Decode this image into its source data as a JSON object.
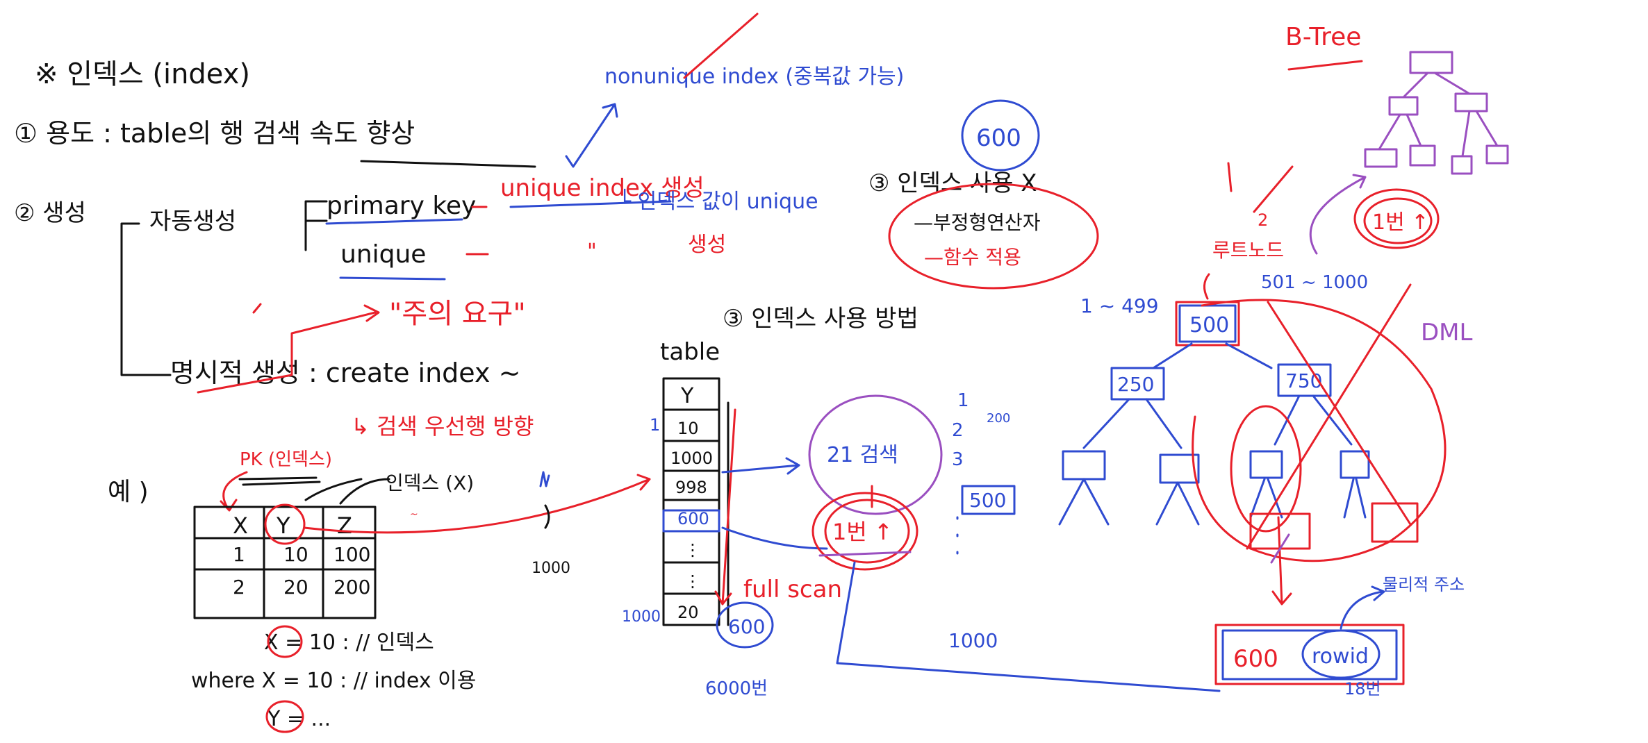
{
  "colors": {
    "ink": "#111111",
    "red": "#e8202a",
    "blue": "#2f4bd1",
    "purple": "#9a4fc0",
    "background": "#ffffff"
  },
  "title": "※ 인덱스 (index)",
  "note1": "① 용도 : table의 행 검색 속도 향상",
  "note2": "② 생성",
  "auto_create": "자동생성",
  "primary_key": "primary key",
  "unique": "unique",
  "unique_index": "unique index 생성",
  "nonunique_index": "nonunique index (중복값 가능)",
  "index_value_unique": "└ 인덱스 값이 unique",
  "create_suffix": "생성",
  "ditto": "\"",
  "manual_create": "명시적 생성 : create index ~",
  "caution": "\"주의 요구\"",
  "search_first": "↳ 검색 우선행 방향",
  "example": "예 )",
  "pk_label": "PK (인덱스)",
  "index_x_label": "인덱스 (X)",
  "table_headers": [
    "X",
    "Y",
    "Z"
  ],
  "table_rows": [
    [
      "1",
      "10",
      "100"
    ],
    [
      "2",
      "20",
      "200"
    ]
  ],
  "where1": "X = 10 : // 인덱스",
  "where2": "where X = 10 : // index 이용",
  "where3": "Y = ...",
  "col_table": "table",
  "col_header": "Y",
  "col_values": [
    "10",
    "1000",
    "998",
    "600",
    "⋮",
    "⋮",
    "20"
  ],
  "col_1": "1",
  "col_1000": "1000",
  "full_scan": "full scan",
  "num_1000_small": "1000",
  "num_600_bottom": "600",
  "num_6000": "6000번",
  "num_600_top": "600",
  "usage3_title": "③ 인덱스 사용 X",
  "usage3_a": "—부정형연산자",
  "usage3_b": "—함수 적용",
  "usage3_section": "③ 인덱스 사용 방법",
  "circle_21": "21 검색",
  "circle_1": "1번 ↑",
  "seq": [
    "1",
    "2",
    "3"
  ],
  "num_200": "200",
  "box_500_mid": "500",
  "btree": "B-Tree",
  "range_left": "1 ~ 499",
  "range_right": "501 ~ 1000",
  "dml": "DML",
  "root_node": "루트노드",
  "root_value": "500",
  "left_child": "250",
  "right_child": "750",
  "circle_right": "1번 ↑",
  "num_2": "2",
  "leaf_value": "600",
  "leaf_rowid": "rowid",
  "physical_addr": "물리적 주소",
  "num_18": "18번",
  "line_1000": "1000"
}
